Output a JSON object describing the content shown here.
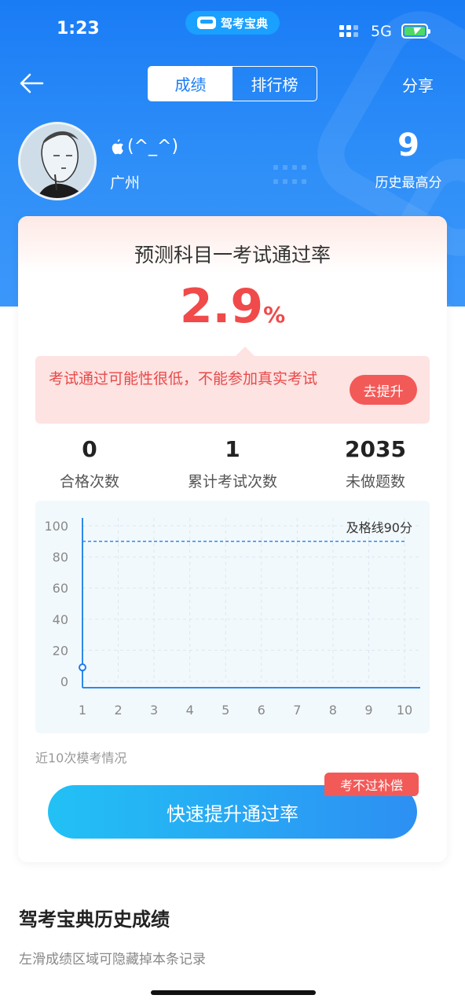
{
  "status_bar": {
    "time": "1:23",
    "app_name": "驾考宝典",
    "network": "5G"
  },
  "nav": {
    "tabs": [
      {
        "label": "成绩",
        "active": true
      },
      {
        "label": "排行榜",
        "active": false
      }
    ],
    "share_label": "分享"
  },
  "profile": {
    "username": "(^_^)",
    "city": "广州",
    "best_score": "9",
    "best_score_label": "历史最高分"
  },
  "card": {
    "title": "预测科目一考试通过率",
    "pass_rate": "2.9",
    "pass_rate_unit": "%",
    "warning": "考试通过可能性很低，不能参加真实考试",
    "improve_button": "去提升",
    "stats": [
      {
        "value": "0",
        "label": "合格次数"
      },
      {
        "value": "1",
        "label": "累计考试次数"
      },
      {
        "value": "2035",
        "label": "未做题数"
      }
    ],
    "chart_note": "近10次模考情况",
    "cta_label": "快速提升通过率",
    "cta_badge": "考不过补偿"
  },
  "chart_data": {
    "type": "line",
    "x": [
      1,
      2,
      3,
      4,
      5,
      6,
      7,
      8,
      9,
      10
    ],
    "xticks": [
      "1",
      "2",
      "3",
      "4",
      "5",
      "6",
      "7",
      "8",
      "9",
      "10"
    ],
    "yticks": [
      "0",
      "20",
      "40",
      "60",
      "80",
      "100"
    ],
    "ylim": [
      0,
      100
    ],
    "series": [
      {
        "values": [
          9,
          null,
          null,
          null,
          null,
          null,
          null,
          null,
          null,
          null
        ],
        "color": "#1a7cf5"
      }
    ],
    "threshold": {
      "value": 90,
      "label": "及格线90分"
    },
    "grid": true
  },
  "history": {
    "title": "驾考宝典历史成绩",
    "subtitle": "左滑成绩区域可隐藏掉本条记录"
  },
  "colors": {
    "primary": "#1a7cf5",
    "danger": "#f04a4a",
    "cta_start": "#22c1f5",
    "cta_end": "#2d8ff3"
  }
}
